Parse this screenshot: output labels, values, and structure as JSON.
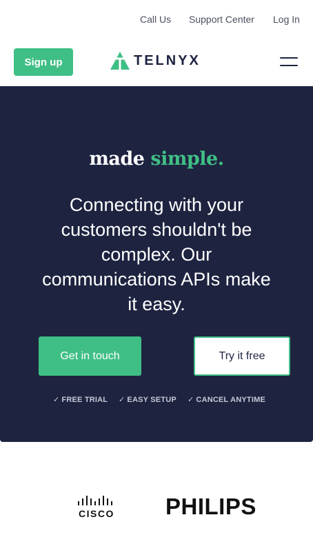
{
  "topnav": {
    "call": "Call Us",
    "support": "Support Center",
    "login": "Log In"
  },
  "header": {
    "signup_label": "Sign up",
    "logo_text": "TELNYX",
    "menu_icon": "hamburger-menu-icon"
  },
  "hero": {
    "tagline_part1": "made",
    "tagline_part2": "simple.",
    "headline": "Connecting with your customers shouldn't be complex. Our communications APIs make it easy.",
    "cta_primary": "Get in touch",
    "cta_secondary": "Try it free",
    "features": [
      "FREE TRIAL",
      "EASY SETUP",
      "CANCEL ANYTIME"
    ]
  },
  "logos": {
    "cisco": "CISCO",
    "philips": "PHILIPS"
  },
  "colors": {
    "accent": "#3fbf85",
    "navy": "#1e2340",
    "white": "#ffffff"
  }
}
